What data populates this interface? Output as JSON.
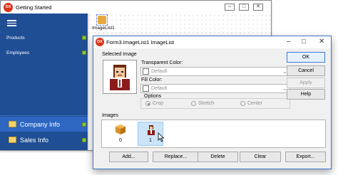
{
  "back_window": {
    "title": "Getting Started",
    "logo_text": "DX",
    "sidebar": {
      "items": [
        {
          "label": "Products"
        },
        {
          "label": "Employees"
        }
      ],
      "big_items": [
        {
          "label": "Company Info"
        },
        {
          "label": "Sales Info"
        }
      ]
    },
    "tray_component_label": "ImageList1",
    "controls": {
      "minimize": "–",
      "maximize": "□",
      "close": "✕"
    }
  },
  "dialog": {
    "logo_text": "DX",
    "title": "Form3.ImageList1 ImageList",
    "controls": {
      "minimize": "–",
      "maximize": "□",
      "close": "✕"
    },
    "selected_image_label": "Selected Image",
    "transparent_color": {
      "label": "Transparent Color:",
      "value": "Default"
    },
    "fill_color": {
      "label": "Fill Color:",
      "value": "Default"
    },
    "options": {
      "label": "Options",
      "choices": [
        {
          "label": "Crop",
          "selected": true
        },
        {
          "label": "Stretch",
          "selected": false
        },
        {
          "label": "Center",
          "selected": false
        }
      ]
    },
    "images_label": "Images",
    "images": [
      {
        "index": "0",
        "icon": "package-icon"
      },
      {
        "index": "1",
        "icon": "person-icon"
      }
    ],
    "side_buttons": [
      {
        "label": "OK"
      },
      {
        "label": "Cancel"
      },
      {
        "label": "Apply"
      },
      {
        "label": "Help"
      }
    ],
    "bottom_buttons": [
      {
        "label": "Add..."
      },
      {
        "label": "Replace..."
      },
      {
        "label": "Delete"
      },
      {
        "label": "Clear"
      },
      {
        "label": "Export..."
      }
    ]
  },
  "colors": {
    "sidebar_bg": "#1f4e94",
    "dialog_border": "#3d77c8",
    "selected_image_bg": "#cce4f7",
    "logo": "#d9331a"
  }
}
